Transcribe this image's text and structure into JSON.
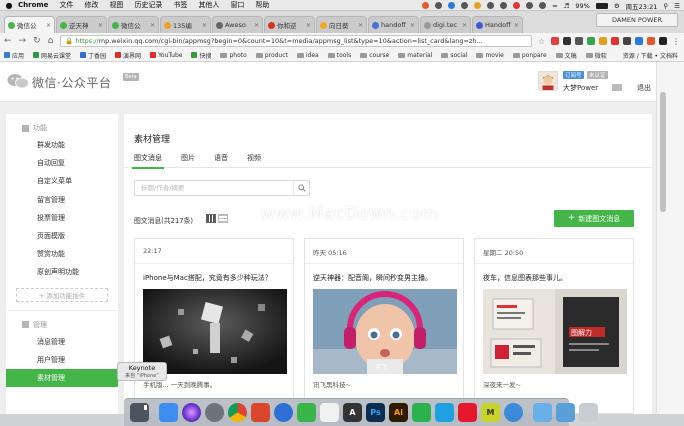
{
  "menubar": {
    "app": "Chrome",
    "items": [
      "文件",
      "修改",
      "视图",
      "历史记录",
      "书签",
      "其他人",
      "窗口",
      "帮助"
    ],
    "battery": "99%",
    "clock": "周五23:21"
  },
  "browser": {
    "tabs": [
      {
        "label": "微信公",
        "color": "#44b549",
        "active": true
      },
      {
        "label": "逆天神",
        "color": "#44b549",
        "active": false
      },
      {
        "label": "微信公",
        "color": "#44b549",
        "active": false
      },
      {
        "label": "135编",
        "color": "#f0a020",
        "active": false
      },
      {
        "label": "Aweso",
        "color": "#666666",
        "active": false
      },
      {
        "label": "你和逆",
        "color": "#d93025",
        "active": false
      },
      {
        "label": "向日葵",
        "color": "#f5a623",
        "active": false
      },
      {
        "label": "handoff",
        "color": "#4a6fd9",
        "active": false
      },
      {
        "label": "digi.tec",
        "color": "#999999",
        "active": false
      },
      {
        "label": "Handoff",
        "color": "#3a5bd9",
        "active": false
      }
    ],
    "tab_close": "×",
    "profile": "DAMEN POWER",
    "url_scheme": "https://",
    "url_rest": "mp.weixin.qq.com/cgi-bin/appmsg?begin=0&count=10&t=media/appmsg_list&type=10&action=list_card&lang=zh...",
    "nav": {
      "back": "←",
      "forward": "→",
      "reload": "↻",
      "home": "⌂"
    },
    "bookmarks": [
      "应用",
      "网易云课堂",
      "丁香园",
      "演界网",
      "YouTube",
      "快搜",
      "photo",
      "product",
      "idea",
      "tools",
      "course",
      "material",
      "social",
      "movie",
      "ponpare",
      "文稿",
      "微软"
    ],
    "other_bookmarks": "资源 / 下载 • 文档料"
  },
  "header": {
    "logo_text": "微信·公众平台",
    "beta": "Beta",
    "badge_subscription": "订阅号",
    "badge_verify": "未认证",
    "username": "大梦Power",
    "logout": "退出"
  },
  "sidebar": {
    "section_function": "功能",
    "function_items": [
      "群发功能",
      "自动回复",
      "自定义菜单",
      "留言管理",
      "投票管理",
      "页面模版",
      "赞赏功能",
      "原创声明功能"
    ],
    "add_plugin": "+ 添加功能插件",
    "section_manage": "管理",
    "manage_items": [
      "消息管理",
      "用户管理",
      "素材管理"
    ],
    "active_item": "素材管理"
  },
  "main": {
    "title": "素材管理",
    "tabs": [
      "图文消息",
      "图片",
      "语音",
      "视频"
    ],
    "search_placeholder": "标题/作者/摘要",
    "count_label": "图文消息(共217条)",
    "new_button": "新建图文消息",
    "cards": [
      {
        "time": "22:17",
        "title": "iPhone与Mac搭配，究竟有多少种玩法？",
        "desc": "手机版... 一天到晚腾事。"
      },
      {
        "time": "昨天 05:16",
        "title": "逆天神器：配音阁，瞬间秒变男主播。",
        "desc": "讯飞黑科技~"
      },
      {
        "time": "星期二 20:50",
        "title": "夜车，信息图表那些事儿。",
        "desc": "深夜来一发~"
      }
    ],
    "card_img_label_2": "讯飞",
    "card_img_label_3": "图解力"
  },
  "watermark": {
    "logo": "M",
    "text": "www.MacDown.com"
  },
  "tooltip": {
    "title": "Keynote",
    "sub": "来自 “iPhone”"
  },
  "dock": {
    "apps": [
      {
        "name": "finder-icon",
        "color": "#3d8ef0",
        "glyph": ""
      },
      {
        "name": "siri-icon",
        "color": "#7a3ad9",
        "glyph": ""
      },
      {
        "name": "launchpad-icon",
        "color": "#6d737a",
        "glyph": ""
      },
      {
        "name": "chrome-icon",
        "color": "#e9b32a",
        "glyph": ""
      },
      {
        "name": "sublime-icon",
        "color": "#d9462b",
        "glyph": ""
      },
      {
        "name": "safari-icon",
        "color": "#2f6fd6",
        "glyph": ""
      },
      {
        "name": "evernote-icon",
        "color": "#3ab54a",
        "glyph": ""
      },
      {
        "name": "calendar-icon",
        "color": "#f1f1f1",
        "glyph": ""
      },
      {
        "name": "a-icon",
        "color": "#333333",
        "glyph": "A"
      },
      {
        "name": "photoshop-icon",
        "color": "#0b2e4e",
        "glyph": "Ps"
      },
      {
        "name": "illustrator-icon",
        "color": "#2e1a00",
        "glyph": "Ai"
      },
      {
        "name": "wechat-icon",
        "color": "#2bb24c",
        "glyph": ""
      },
      {
        "name": "qq-icon",
        "color": "#1fa0e0",
        "glyph": ""
      },
      {
        "name": "weibo-icon",
        "color": "#e6162d",
        "glyph": ""
      },
      {
        "name": "m-icon",
        "color": "#c9d42a",
        "glyph": "M"
      },
      {
        "name": "settings-icon",
        "color": "#3a8ad9",
        "glyph": ""
      },
      {
        "name": "folder-icon",
        "color": "#6ab0e8",
        "glyph": ""
      },
      {
        "name": "downloads-icon",
        "color": "#5aa0d8",
        "glyph": ""
      },
      {
        "name": "trash-icon",
        "color": "#c8cdd2",
        "glyph": ""
      }
    ]
  }
}
